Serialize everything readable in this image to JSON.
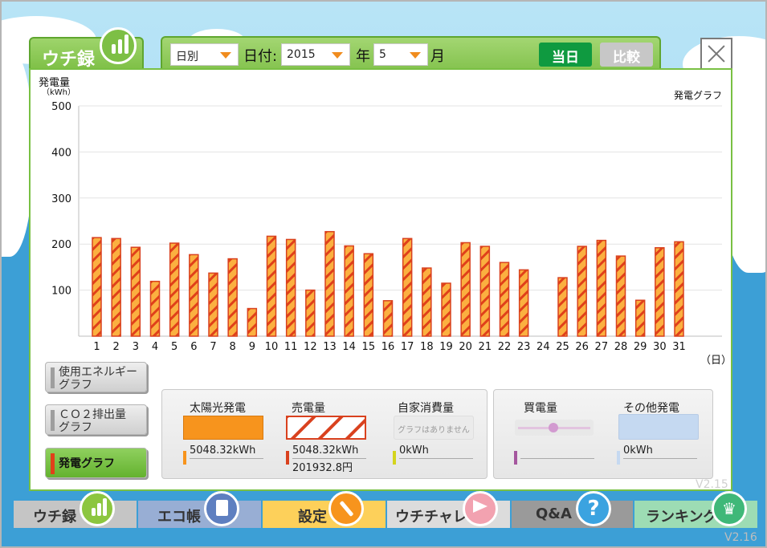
{
  "app": {
    "tab_title": "ウチ録",
    "version_inner": "V2.15",
    "version_outer": "V2.16"
  },
  "toolbar": {
    "mode_select": "日別",
    "date_label": "日付:",
    "year_value": "2015",
    "year_label": "年",
    "month_value": "5",
    "month_label": "月",
    "today_button": "当日",
    "compare_button": "比較",
    "colors": {
      "today": "#0f9a40",
      "compare": "#c7c7c7"
    }
  },
  "chart_data": {
    "type": "bar",
    "title": "発電グラフ",
    "ylabel": "発電量",
    "yunit": "（kWh）",
    "xunit": "（日）",
    "ylim": [
      0,
      500
    ],
    "yticks": [
      100,
      200,
      300,
      400,
      500
    ],
    "grid": true,
    "categories": [
      "1",
      "2",
      "3",
      "4",
      "5",
      "6",
      "7",
      "8",
      "9",
      "10",
      "11",
      "12",
      "13",
      "14",
      "15",
      "16",
      "17",
      "18",
      "19",
      "20",
      "21",
      "22",
      "23",
      "24",
      "25",
      "26",
      "27",
      "28",
      "29",
      "30",
      "31"
    ],
    "series": [
      {
        "values": [
          214,
          212,
          193,
          119,
          202,
          177,
          137,
          168,
          60,
          217,
          210,
          100,
          227,
          196,
          179,
          77,
          212,
          148,
          115,
          203,
          195,
          160,
          144,
          0,
          127,
          195,
          208,
          174,
          78,
          192,
          205
        ],
        "color": "#f7941d",
        "stripe": "#d9411e"
      }
    ]
  },
  "side_buttons": [
    {
      "label_1": "使用エネルギー",
      "label_2": "グラフ"
    },
    {
      "label_1": "ＣＯ２排出量",
      "label_2": "グラフ"
    },
    {
      "label_1": "発電グラフ"
    }
  ],
  "legend": {
    "solar": {
      "title": "太陽光発電",
      "value": "5048.32kWh",
      "color": "#f7941d"
    },
    "sold": {
      "title": "売電量",
      "value": "5048.32kWh",
      "value2": "201932.8円",
      "color": "#d9411e"
    },
    "self": {
      "title": "自家消費量",
      "note": "グラフはありません",
      "value": "0kWh",
      "color": "#d4d41c"
    },
    "bought": {
      "title": "買電量",
      "value": "",
      "color": "#a5579e"
    },
    "other": {
      "title": "その他発電",
      "value": "0kWh",
      "color": "#c5d9f1"
    }
  },
  "nav": [
    {
      "label": "ウチ録",
      "color": "#c5c5c5",
      "icon_color": "#8cc63f",
      "icon": "bar-chart-icon"
    },
    {
      "label": "エコ帳",
      "color": "#98aed4",
      "icon_color": "#5e7fc0",
      "icon": "notebook-icon"
    },
    {
      "label": "設定",
      "color": "#fdd05a",
      "icon_color": "#f7941d",
      "icon": "wrench-icon"
    },
    {
      "label": "ウチチャレ",
      "color": "#dcdcdc",
      "icon_color": "#f2a2b0",
      "icon": "flag-icon"
    },
    {
      "label": "Q&A",
      "color": "#9a9a9a",
      "icon_color": "#3ba3e0",
      "icon": "question-icon"
    },
    {
      "label": "ランキング",
      "color": "#9ddcb4",
      "icon_color": "#3fb878",
      "icon": "crown-icon"
    }
  ]
}
